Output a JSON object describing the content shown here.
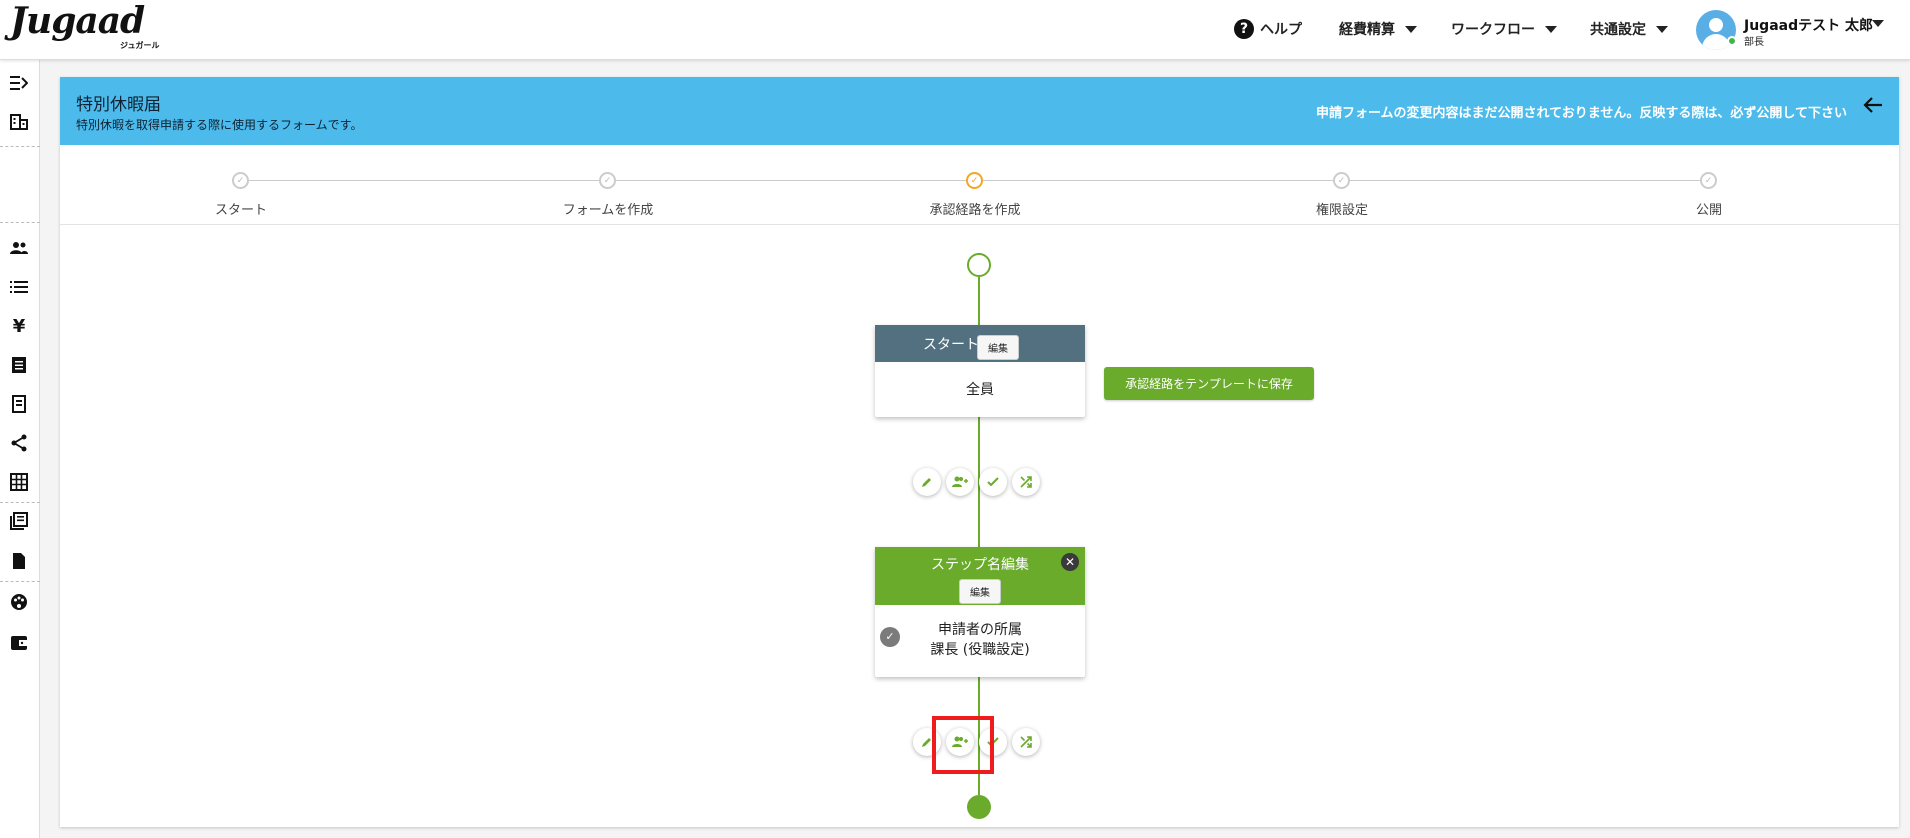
{
  "header": {
    "logo_main": "Jugaad",
    "logo_sub": "ジュガール",
    "nav": {
      "help": "ヘルプ",
      "expense": "経費精算",
      "workflow": "ワークフロー",
      "common": "共通設定"
    },
    "user": {
      "name": "Jugaadテスト 太郎",
      "role": "部長"
    }
  },
  "banner": {
    "title": "特別休暇届",
    "description": "特別休暇を取得申請する際に使用するフォームです。",
    "warning": "申請フォームの変更内容はまだ公開されておりません。反映する際は、必ず公開して下さい"
  },
  "stepper": {
    "steps": [
      {
        "label": "スタート",
        "status": "done"
      },
      {
        "label": "フォームを作成",
        "status": "done"
      },
      {
        "label": "承認経路を作成",
        "status": "active"
      },
      {
        "label": "権限設定",
        "status": "pending"
      },
      {
        "label": "公開",
        "status": "pending"
      }
    ]
  },
  "flow": {
    "start_node": {
      "title": "スタート",
      "edit_label": "編集",
      "body": "全員"
    },
    "save_template_label": "承認経路をテンプレートに保存",
    "step_node": {
      "title": "ステップ名編集",
      "edit_label": "編集",
      "body_line1": "申請者の所属",
      "body_line2": "課長 (役職設定)"
    }
  },
  "colors": {
    "banner": "#4cbbeb",
    "accent_green": "#6bab2b",
    "start_head": "#52707f",
    "active_step": "#f5a623",
    "highlight": "#ee1c1c"
  }
}
